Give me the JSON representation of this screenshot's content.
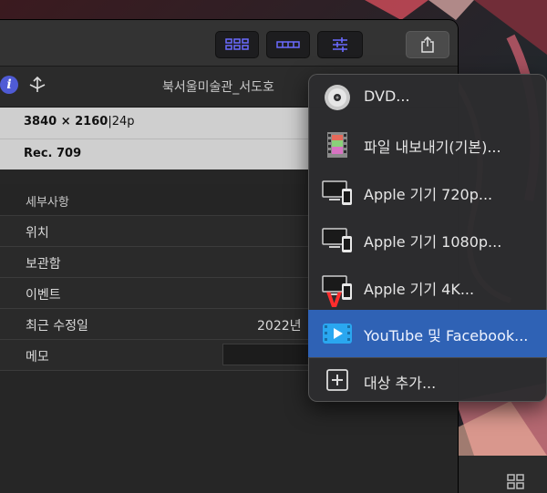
{
  "window": {
    "toolbar": {
      "buttons": [
        {
          "name": "browser-view",
          "icon": "grid-icon"
        },
        {
          "name": "timeline-view",
          "icon": "filmstrip-icon"
        },
        {
          "name": "inspector-adjustments",
          "icon": "sliders-icon"
        },
        {
          "name": "share",
          "icon": "share-icon"
        }
      ]
    },
    "info_bar": {
      "info_icon_glyph": "i",
      "clip_title": "북서울미술관_서도호"
    },
    "specs": {
      "resolution": "3840 × 2160",
      "separator": "|",
      "frame_rate": "24p",
      "color_space": "Rec. 709"
    },
    "details": {
      "section_title": "세부사항",
      "rows": [
        {
          "label": "위치",
          "value": ""
        },
        {
          "label": "보관함",
          "value": ""
        },
        {
          "label": "이벤트",
          "value": ""
        },
        {
          "label": "최근 수정일",
          "value": "2022년"
        },
        {
          "label": "메모",
          "value": ""
        }
      ]
    }
  },
  "share_menu": {
    "items": [
      {
        "label": "DVD...",
        "icon": "dvd-disc-icon"
      },
      {
        "label": "파일 내보내기(기본)...",
        "icon": "film-file-icon"
      },
      {
        "label": "Apple 기기 720p...",
        "icon": "apple-devices-icon"
      },
      {
        "label": "Apple 기기 1080p...",
        "icon": "apple-devices-icon"
      },
      {
        "label": "Apple 기기 4K...",
        "icon": "apple-devices-icon"
      },
      {
        "label": "YouTube 및 Facebook...",
        "icon": "video-play-icon",
        "selected": true
      },
      {
        "label": "대상 추가...",
        "icon": "plus-box-icon"
      }
    ],
    "annotation_mark": "V"
  },
  "colors": {
    "accent": "#4f5bd5",
    "selection": "#2f62b5",
    "annotation": "#ff2d2d"
  }
}
